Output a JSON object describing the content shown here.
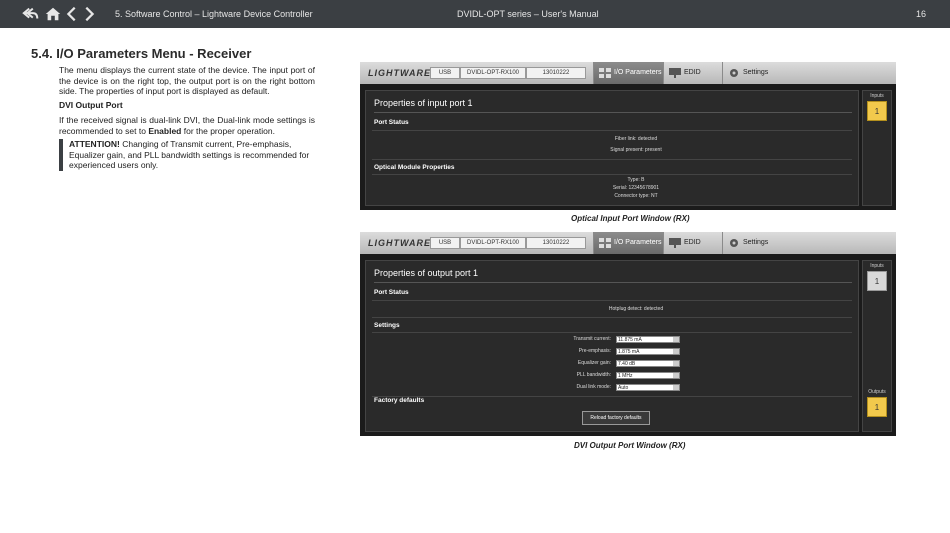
{
  "header": {
    "left_title": "5. Software Control – Lightware Device Controller",
    "center_title": "DVIDL-OPT series – User's Manual",
    "page_number": "16"
  },
  "section": {
    "title": "5.4. I/O Parameters Menu - Receiver",
    "intro": "The menu displays the current state of the device. The input port of the device is on the right top, the output port is on the right bottom side. The properties of input port is displayed as default.",
    "subheading": "DVI Output Port",
    "para2_a": "If the received signal is dual-link DVI, the Dual-link mode settings is recommended to set to",
    "para2_bold": "Enabled",
    "para2_b": "for the proper operation.",
    "attention_label": "ATTENTION!",
    "attention_text": "Changing of Transmit current, Pre-emphasis, Equalizer gain, and PLL bandwidth settings is recommended for experienced users only."
  },
  "app": {
    "logo": "LIGHTWARE",
    "field_usb": "USB",
    "field_model": "DVIDL-OPT-RX100",
    "field_serial": "13010222",
    "tab_io": "I/O Parameters",
    "tab_edid": "EDID",
    "tab_settings": "Settings"
  },
  "window1": {
    "panel_title": "Properties of input port 1",
    "port_status": "Port Status",
    "fiber_link": "Fiber link: detected",
    "signal_present": "Signal present: present",
    "optical_props": "Optical Module Properties",
    "type": "Type: B",
    "serial": "Serial: 12345678901",
    "connector": "Connector type: NT",
    "inputs_label": "Inputs",
    "input_port": "1",
    "caption": "Optical Input Port Window (RX)"
  },
  "window2": {
    "panel_title": "Properties of output port 1",
    "port_status": "Port Status",
    "hotplug": "Hotplug detect: detected",
    "settings": "Settings",
    "transmit_label": "Transmit current:",
    "transmit_value": "11.875 mA",
    "preemph_label": "Pre-emphasis:",
    "preemph_value": "1.875 mA",
    "eq_label": "Equalizer gain:",
    "eq_value": "7.40 dB",
    "pll_label": "PLL bandwidth:",
    "pll_value": "1 MHz",
    "dual_label": "Dual link mode:",
    "dual_value": "Auto",
    "factory": "Factory defaults",
    "reload": "Reload factory defaults",
    "inputs_label": "Inputs",
    "input_port": "1",
    "outputs_label": "Outputs",
    "output_port": "1",
    "caption": "DVI Output Port Window (RX)"
  }
}
